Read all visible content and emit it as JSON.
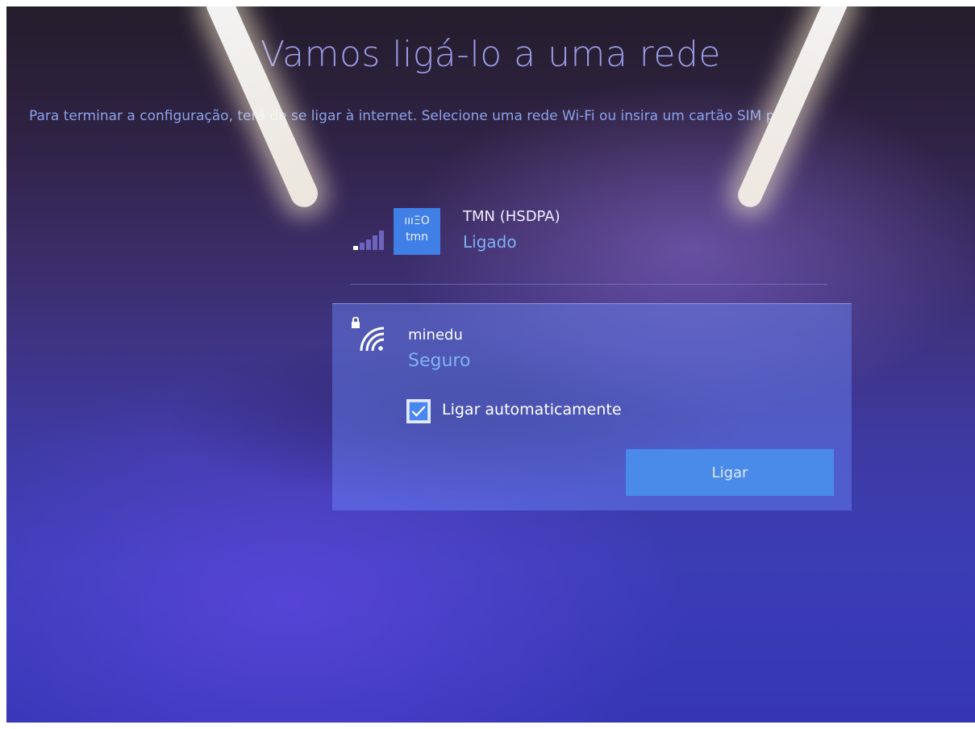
{
  "header": {
    "title": "Vamos ligá-lo a uma rede",
    "subtitle": "Para terminar a configuração, terá de se ligar à internet. Selecione uma rede Wi-Fi ou insira um cartão SIM p"
  },
  "networks": {
    "cellular": {
      "logo_top": "ıııΞO",
      "logo_bottom": "tmn",
      "name": "TMN (HSDPA)",
      "status": "Ligado",
      "signal_bars_active": 1,
      "signal_bars_total": 5
    },
    "wifi": {
      "name": "minedu",
      "status": "Seguro",
      "auto_connect_label": "Ligar automaticamente",
      "auto_connect_checked": true,
      "connect_label": "Ligar"
    }
  },
  "colors": {
    "accent": "#4a8bea",
    "status_text": "#7fb2f5"
  }
}
